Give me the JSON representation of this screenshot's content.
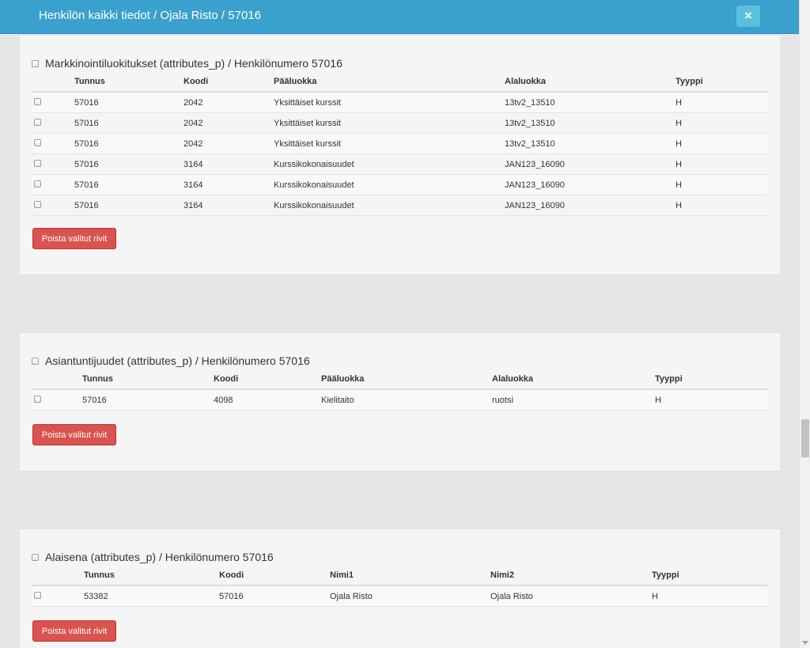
{
  "header": {
    "title": "Henkilön kaikki tiedot / Ojala Risto / 57016",
    "close_label": "×"
  },
  "sections": [
    {
      "title": "Markkinointiluokitukset (attributes_p) / Henkilönumero 57016",
      "columns": [
        "Tunnus",
        "Koodi",
        "Pääluokka",
        "Alaluokka",
        "Tyyppi"
      ],
      "rows": [
        [
          "57016",
          "2042",
          "Yksittäiset kurssit",
          "13tv2_13510",
          "H"
        ],
        [
          "57016",
          "2042",
          "Yksittäiset kurssit",
          "13tv2_13510",
          "H"
        ],
        [
          "57016",
          "2042",
          "Yksittäiset kurssit",
          "13tv2_13510",
          "H"
        ],
        [
          "57016",
          "3164",
          "Kurssikokonaisuudet",
          "JAN123_16090",
          "H"
        ],
        [
          "57016",
          "3164",
          "Kurssikokonaisuudet",
          "JAN123_16090",
          "H"
        ],
        [
          "57016",
          "3164",
          "Kurssikokonaisuudet",
          "JAN123_16090",
          "H"
        ]
      ],
      "delete_label": "Poista valitut rivit"
    },
    {
      "title": "Asiantuntijuudet (attributes_p) / Henkilönumero 57016",
      "columns": [
        "Tunnus",
        "Koodi",
        "Pääluokka",
        "Alaluokka",
        "Tyyppi"
      ],
      "rows": [
        [
          "57016",
          "4098",
          "Kielitaito",
          "ruotsi",
          "H"
        ]
      ],
      "delete_label": "Poista valitut rivit"
    },
    {
      "title": "Alaisena (attributes_p) / Henkilönumero 57016",
      "columns": [
        "Tunnus",
        "Koodi",
        "Nimi1",
        "Nimi2",
        "Tyyppi"
      ],
      "rows": [
        [
          "53382",
          "57016",
          "Ojala Risto",
          "Ojala Risto",
          "H"
        ]
      ],
      "delete_label": "Poista valitut rivit"
    }
  ]
}
